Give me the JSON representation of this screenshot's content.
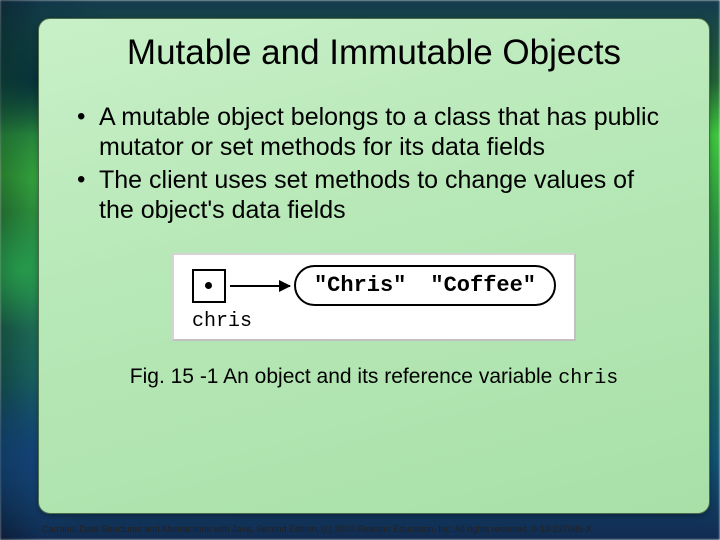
{
  "title": "Mutable and Immutable Objects",
  "bullets": [
    "A mutable object belongs to a class that has public mutator or set methods for its data fields",
    "The client uses set methods to change values of the object's data fields"
  ],
  "diagram": {
    "variable_name": "chris",
    "object_fields": [
      "\"Chris\"",
      "\"Coffee\""
    ]
  },
  "caption_prefix": "Fig. 15 -1 An object and its reference variable ",
  "caption_var": "chris",
  "footer_left": "Carrano, Data Structures and Abstractions with Java, Second Edition, (c) 2007 Pearson Education, Inc. All rights reserved. 0-13-237045-X",
  "footer_right": ""
}
